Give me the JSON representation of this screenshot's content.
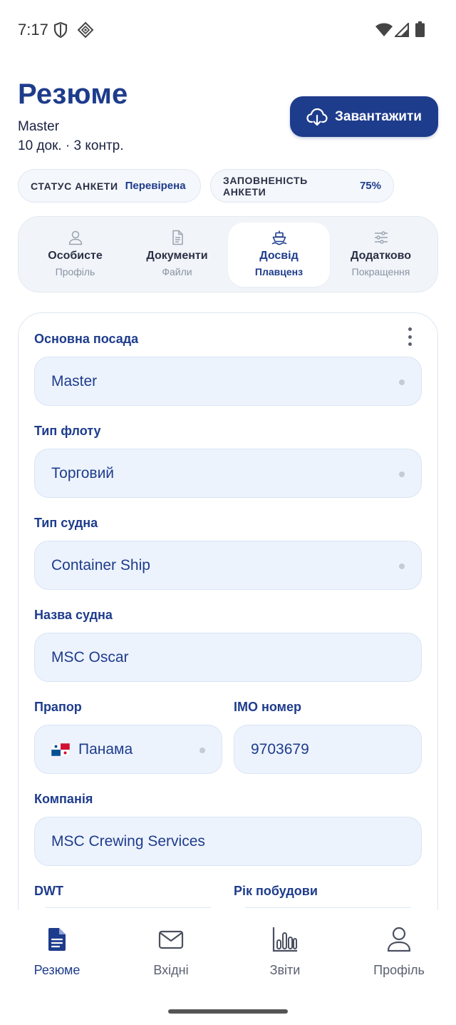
{
  "status_bar": {
    "time": "7:17"
  },
  "header": {
    "title": "Резюме",
    "rank": "Master",
    "docs_summary": "10 док. · 3 контр.",
    "download_label": "Завантажити"
  },
  "chips": {
    "status_label": "СТАТУС АНКЕТИ",
    "status_value": "Перевірена",
    "fill_label": "ЗАПОВНЕНІСТЬ АНКЕТИ",
    "fill_value": "75%"
  },
  "tabs": [
    {
      "title": "Особисте",
      "subtitle": "Профіль",
      "icon": "person-icon",
      "active": false
    },
    {
      "title": "Документи",
      "subtitle": "Файли",
      "icon": "document-icon",
      "active": false
    },
    {
      "title": "Досвід",
      "subtitle": "Плавценз",
      "icon": "ship-icon",
      "active": true
    },
    {
      "title": "Додатково",
      "subtitle": "Покращення",
      "icon": "sliders-icon",
      "active": false
    }
  ],
  "form": {
    "position": {
      "label": "Основна посада",
      "value": "Master"
    },
    "fleet_type": {
      "label": "Тип флоту",
      "value": "Торговий"
    },
    "vessel_type": {
      "label": "Тип судна",
      "value": "Container Ship"
    },
    "vessel_name": {
      "label": "Назва судна",
      "value": "MSC Oscar"
    },
    "flag": {
      "label": "Прапор",
      "value": "Панама",
      "flag_icon": "panama-flag-icon"
    },
    "imo": {
      "label": "IMO номер",
      "value": "9703679"
    },
    "company": {
      "label": "Компанія",
      "value": "MSC Crewing Services"
    },
    "dwt": {
      "label": "DWT"
    },
    "build_year": {
      "label": "Рік побудови"
    }
  },
  "bottom_nav": [
    {
      "label": "Резюме",
      "icon": "resume-icon",
      "active": true
    },
    {
      "label": "Вхідні",
      "icon": "mail-icon",
      "active": false
    },
    {
      "label": "Звіти",
      "icon": "chart-icon",
      "active": false
    },
    {
      "label": "Профіль",
      "icon": "profile-icon",
      "active": false
    }
  ],
  "colors": {
    "accent": "#1e3c8c",
    "field_bg": "#edf3fd",
    "muted": "#8a93a3"
  }
}
